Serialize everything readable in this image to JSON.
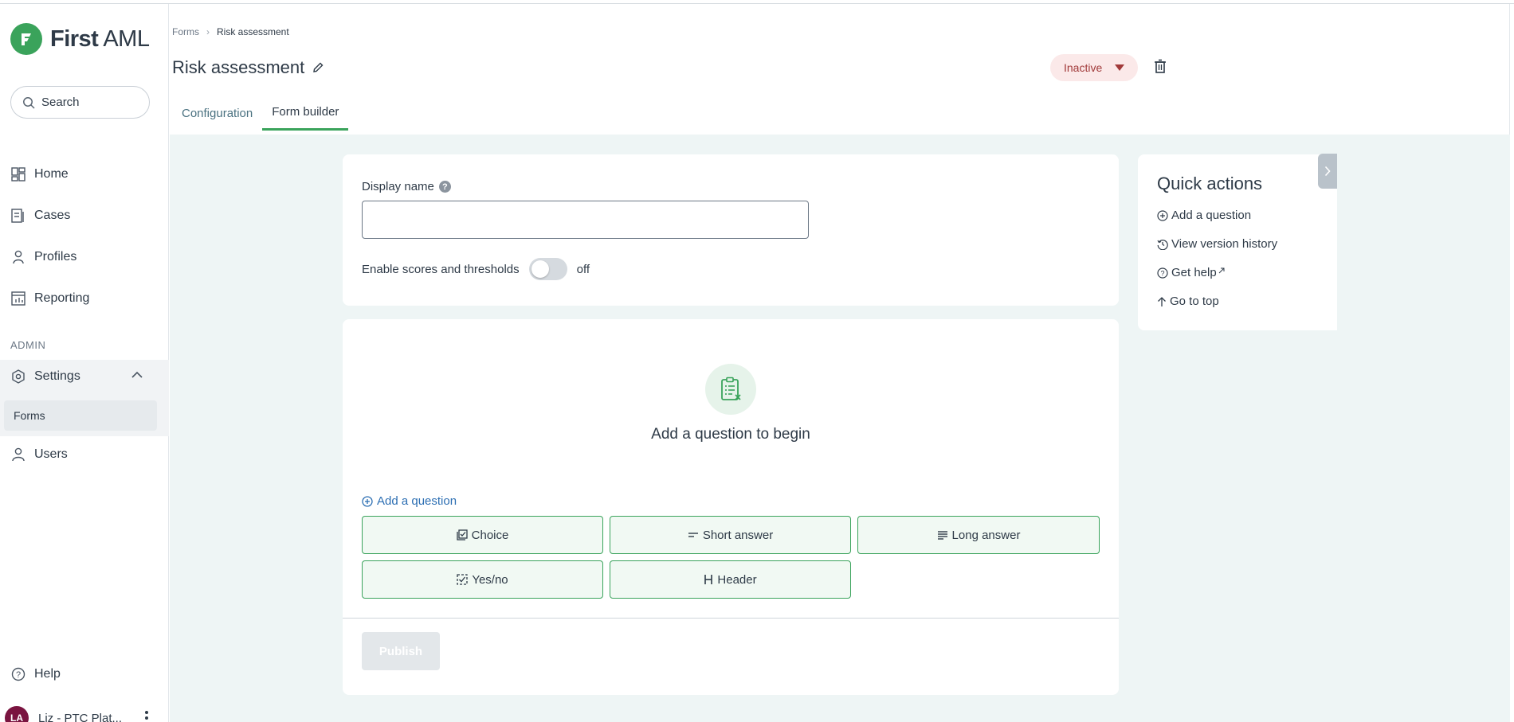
{
  "app": {
    "logo_first": "First",
    "logo_aml": "AML"
  },
  "sidebar": {
    "search_placeholder": "Search",
    "items": [
      {
        "label": "Home",
        "icon": "dashboard-icon"
      },
      {
        "label": "Cases",
        "icon": "cases-icon"
      },
      {
        "label": "Profiles",
        "icon": "person-icon"
      },
      {
        "label": "Reporting",
        "icon": "report-icon"
      }
    ],
    "admin_label": "ADMIN",
    "settings_label": "Settings",
    "forms_label": "Forms",
    "users_label": "Users",
    "help_label": "Help",
    "user": {
      "initials": "LA",
      "name": "Liz - PTC Plat..."
    }
  },
  "header": {
    "breadcrumb": {
      "parent": "Forms",
      "current": "Risk assessment"
    },
    "title": "Risk assessment",
    "tabs": [
      {
        "label": "Configuration",
        "active": false
      },
      {
        "label": "Form builder",
        "active": true
      }
    ],
    "status": "Inactive"
  },
  "settings_card": {
    "display_name_label": "Display name",
    "display_name_value": "",
    "help_glyph": "?",
    "scores_label": "Enable scores and thresholds",
    "scores_state": "off"
  },
  "builder": {
    "empty_title": "Add a question to begin",
    "add_question": "Add a question",
    "question_types": [
      "Choice",
      "Short answer",
      "Long answer",
      "Yes/no",
      "Header"
    ],
    "publish": "Publish"
  },
  "quick_actions": {
    "title": "Quick actions",
    "links": [
      "Add a question",
      "View version history",
      "Get help",
      "Go to top"
    ]
  },
  "colors": {
    "brand": "#3aa35b",
    "link": "#2d6fb3",
    "status_bg": "#fbe9e9",
    "status_text": "#a13a3a"
  }
}
